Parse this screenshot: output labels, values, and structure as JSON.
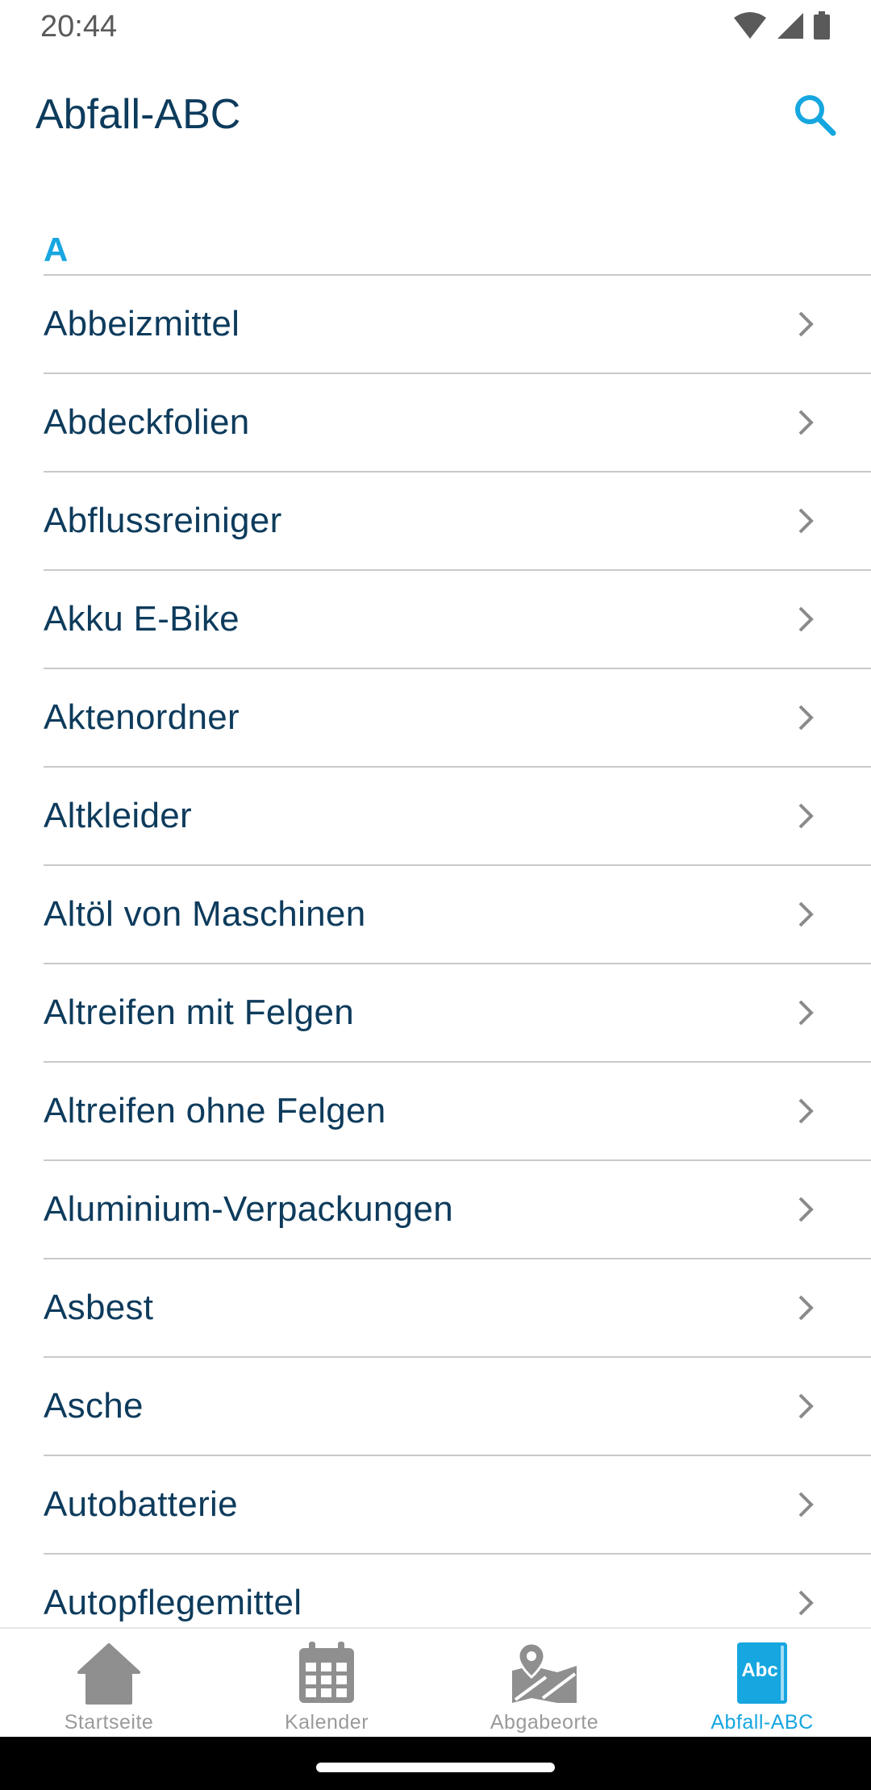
{
  "status": {
    "time": "20:44"
  },
  "header": {
    "title": "Abfall-ABC",
    "search_icon": "search-icon"
  },
  "section": {
    "letter": "A"
  },
  "items": [
    {
      "label": "Abbeizmittel"
    },
    {
      "label": "Abdeckfolien"
    },
    {
      "label": "Abflussreiniger"
    },
    {
      "label": "Akku E-Bike"
    },
    {
      "label": "Aktenordner"
    },
    {
      "label": "Altkleider"
    },
    {
      "label": "Altöl von Maschinen"
    },
    {
      "label": "Altreifen mit Felgen"
    },
    {
      "label": "Altreifen ohne Felgen"
    },
    {
      "label": "Aluminium-Verpackungen"
    },
    {
      "label": "Asbest"
    },
    {
      "label": "Asche"
    },
    {
      "label": "Autobatterie"
    },
    {
      "label": "Autopflegemittel"
    }
  ],
  "nav": [
    {
      "label": "Startseite",
      "icon": "home-icon"
    },
    {
      "label": "Kalender",
      "icon": "calendar-icon"
    },
    {
      "label": "Abgabeorte",
      "icon": "map-pin-icon"
    },
    {
      "label": "Abfall-ABC",
      "icon": "abc-book-icon",
      "icon_text": "Abc",
      "active": true
    }
  ],
  "colors": {
    "primary_text": "#0d3b5c",
    "accent": "#16a6e0",
    "inactive": "#9a9a9a",
    "divider": "#c9c9c9"
  }
}
